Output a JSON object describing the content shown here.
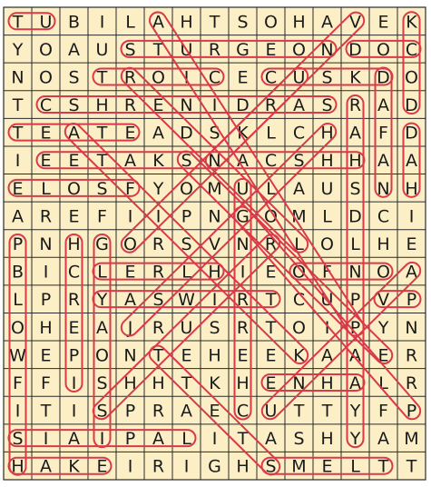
{
  "puzzle": {
    "rows": [
      "TUBILAHTSOHAVEK",
      "YOAUSTURGEONDOC",
      "NOSTROICECUSKDO",
      "TCSHRENIDRASRAD",
      "TEATEADSKLCHAFD",
      "IEETAKSNACSHHAA",
      "ELOSFYOMULAUSNH",
      "AREFIIPNGOMLDCI",
      "PNHGORSVNRLOLHE",
      "BICLERLHIEOFNOA",
      "LPRYASWIRTCUPVP",
      "OHEAJRUSRTOIPYN",
      "WEPONTEHEEKAAER",
      "FFISHHTKHENHALR",
      "ITISPRAECUTTYFP",
      "SIAIPALITASHYAM",
      "HAKEIRIGHSMELTT"
    ],
    "loop_color": "#d93a4a",
    "grid_line_color": "#2a2a2a",
    "cell_color": "#fcefc6",
    "found_words": [
      {
        "r1": 0,
        "c1": 0,
        "r2": 0,
        "c2": 1
      },
      {
        "r1": 0,
        "c1": 14,
        "r2": 3,
        "c2": 14
      },
      {
        "r1": 1,
        "c1": 4,
        "r2": 1,
        "c2": 11
      },
      {
        "r1": 1,
        "c1": 12,
        "r2": 1,
        "c2": 14
      },
      {
        "r1": 2,
        "c1": 9,
        "r2": 2,
        "c2": 13
      },
      {
        "r1": 2,
        "c1": 3,
        "r2": 2,
        "c2": 7
      },
      {
        "r1": 3,
        "c1": 1,
        "r2": 3,
        "c2": 11
      },
      {
        "r1": 3,
        "c1": 12,
        "r2": 15,
        "c2": 12
      },
      {
        "r1": 4,
        "c1": 0,
        "r2": 4,
        "c2": 4
      },
      {
        "r1": 5,
        "c1": 1,
        "r2": 5,
        "c2": 12
      },
      {
        "r1": 6,
        "c1": 0,
        "r2": 6,
        "c2": 4
      },
      {
        "r1": 2,
        "c1": 13,
        "r2": 6,
        "c2": 13
      },
      {
        "r1": 4,
        "c1": 14,
        "r2": 6,
        "c2": 14
      },
      {
        "r1": 8,
        "c1": 3,
        "r2": 15,
        "c2": 3
      },
      {
        "r1": 9,
        "c1": 3,
        "r2": 9,
        "c2": 7
      },
      {
        "r1": 9,
        "c1": 10,
        "r2": 9,
        "c2": 13
      },
      {
        "r1": 10,
        "c1": 3,
        "r2": 10,
        "c2": 9
      },
      {
        "r1": 10,
        "c1": 13,
        "r2": 10,
        "c2": 14
      },
      {
        "r1": 13,
        "c1": 9,
        "r2": 13,
        "c2": 12
      },
      {
        "r1": 15,
        "c1": 0,
        "r2": 15,
        "c2": 6
      },
      {
        "r1": 16,
        "c1": 0,
        "r2": 16,
        "c2": 3
      },
      {
        "r1": 16,
        "c1": 9,
        "r2": 16,
        "c2": 13
      },
      {
        "r1": 8,
        "c1": 0,
        "r2": 16,
        "c2": 0
      },
      {
        "r1": 8,
        "c1": 2,
        "r2": 13,
        "c2": 2
      },
      {
        "r1": 6,
        "c1": 8,
        "r2": 14,
        "c2": 8
      },
      {
        "r1": 12,
        "c1": 5,
        "r2": 16,
        "c2": 9
      },
      {
        "r1": 7,
        "c1": 8,
        "r2": 14,
        "c2": 14
      },
      {
        "r1": 5,
        "c1": 6,
        "r2": 12,
        "c2": 13
      },
      {
        "r1": 0,
        "c1": 5,
        "r2": 11,
        "c2": 12
      },
      {
        "r1": 2,
        "c1": 4,
        "r2": 8,
        "c2": 10
      },
      {
        "r1": 0,
        "c1": 12,
        "r2": 5,
        "c2": 7
      },
      {
        "r1": 4,
        "c1": 2,
        "r2": 12,
        "c2": 10
      },
      {
        "r1": 9,
        "c1": 14,
        "r2": 14,
        "c2": 9
      },
      {
        "r1": 4,
        "c1": 11,
        "r2": 11,
        "c2": 4
      },
      {
        "r1": 8,
        "c1": 9,
        "r2": 14,
        "c2": 3
      },
      {
        "r1": 2,
        "c1": 10,
        "r2": 8,
        "c2": 4
      }
    ]
  }
}
